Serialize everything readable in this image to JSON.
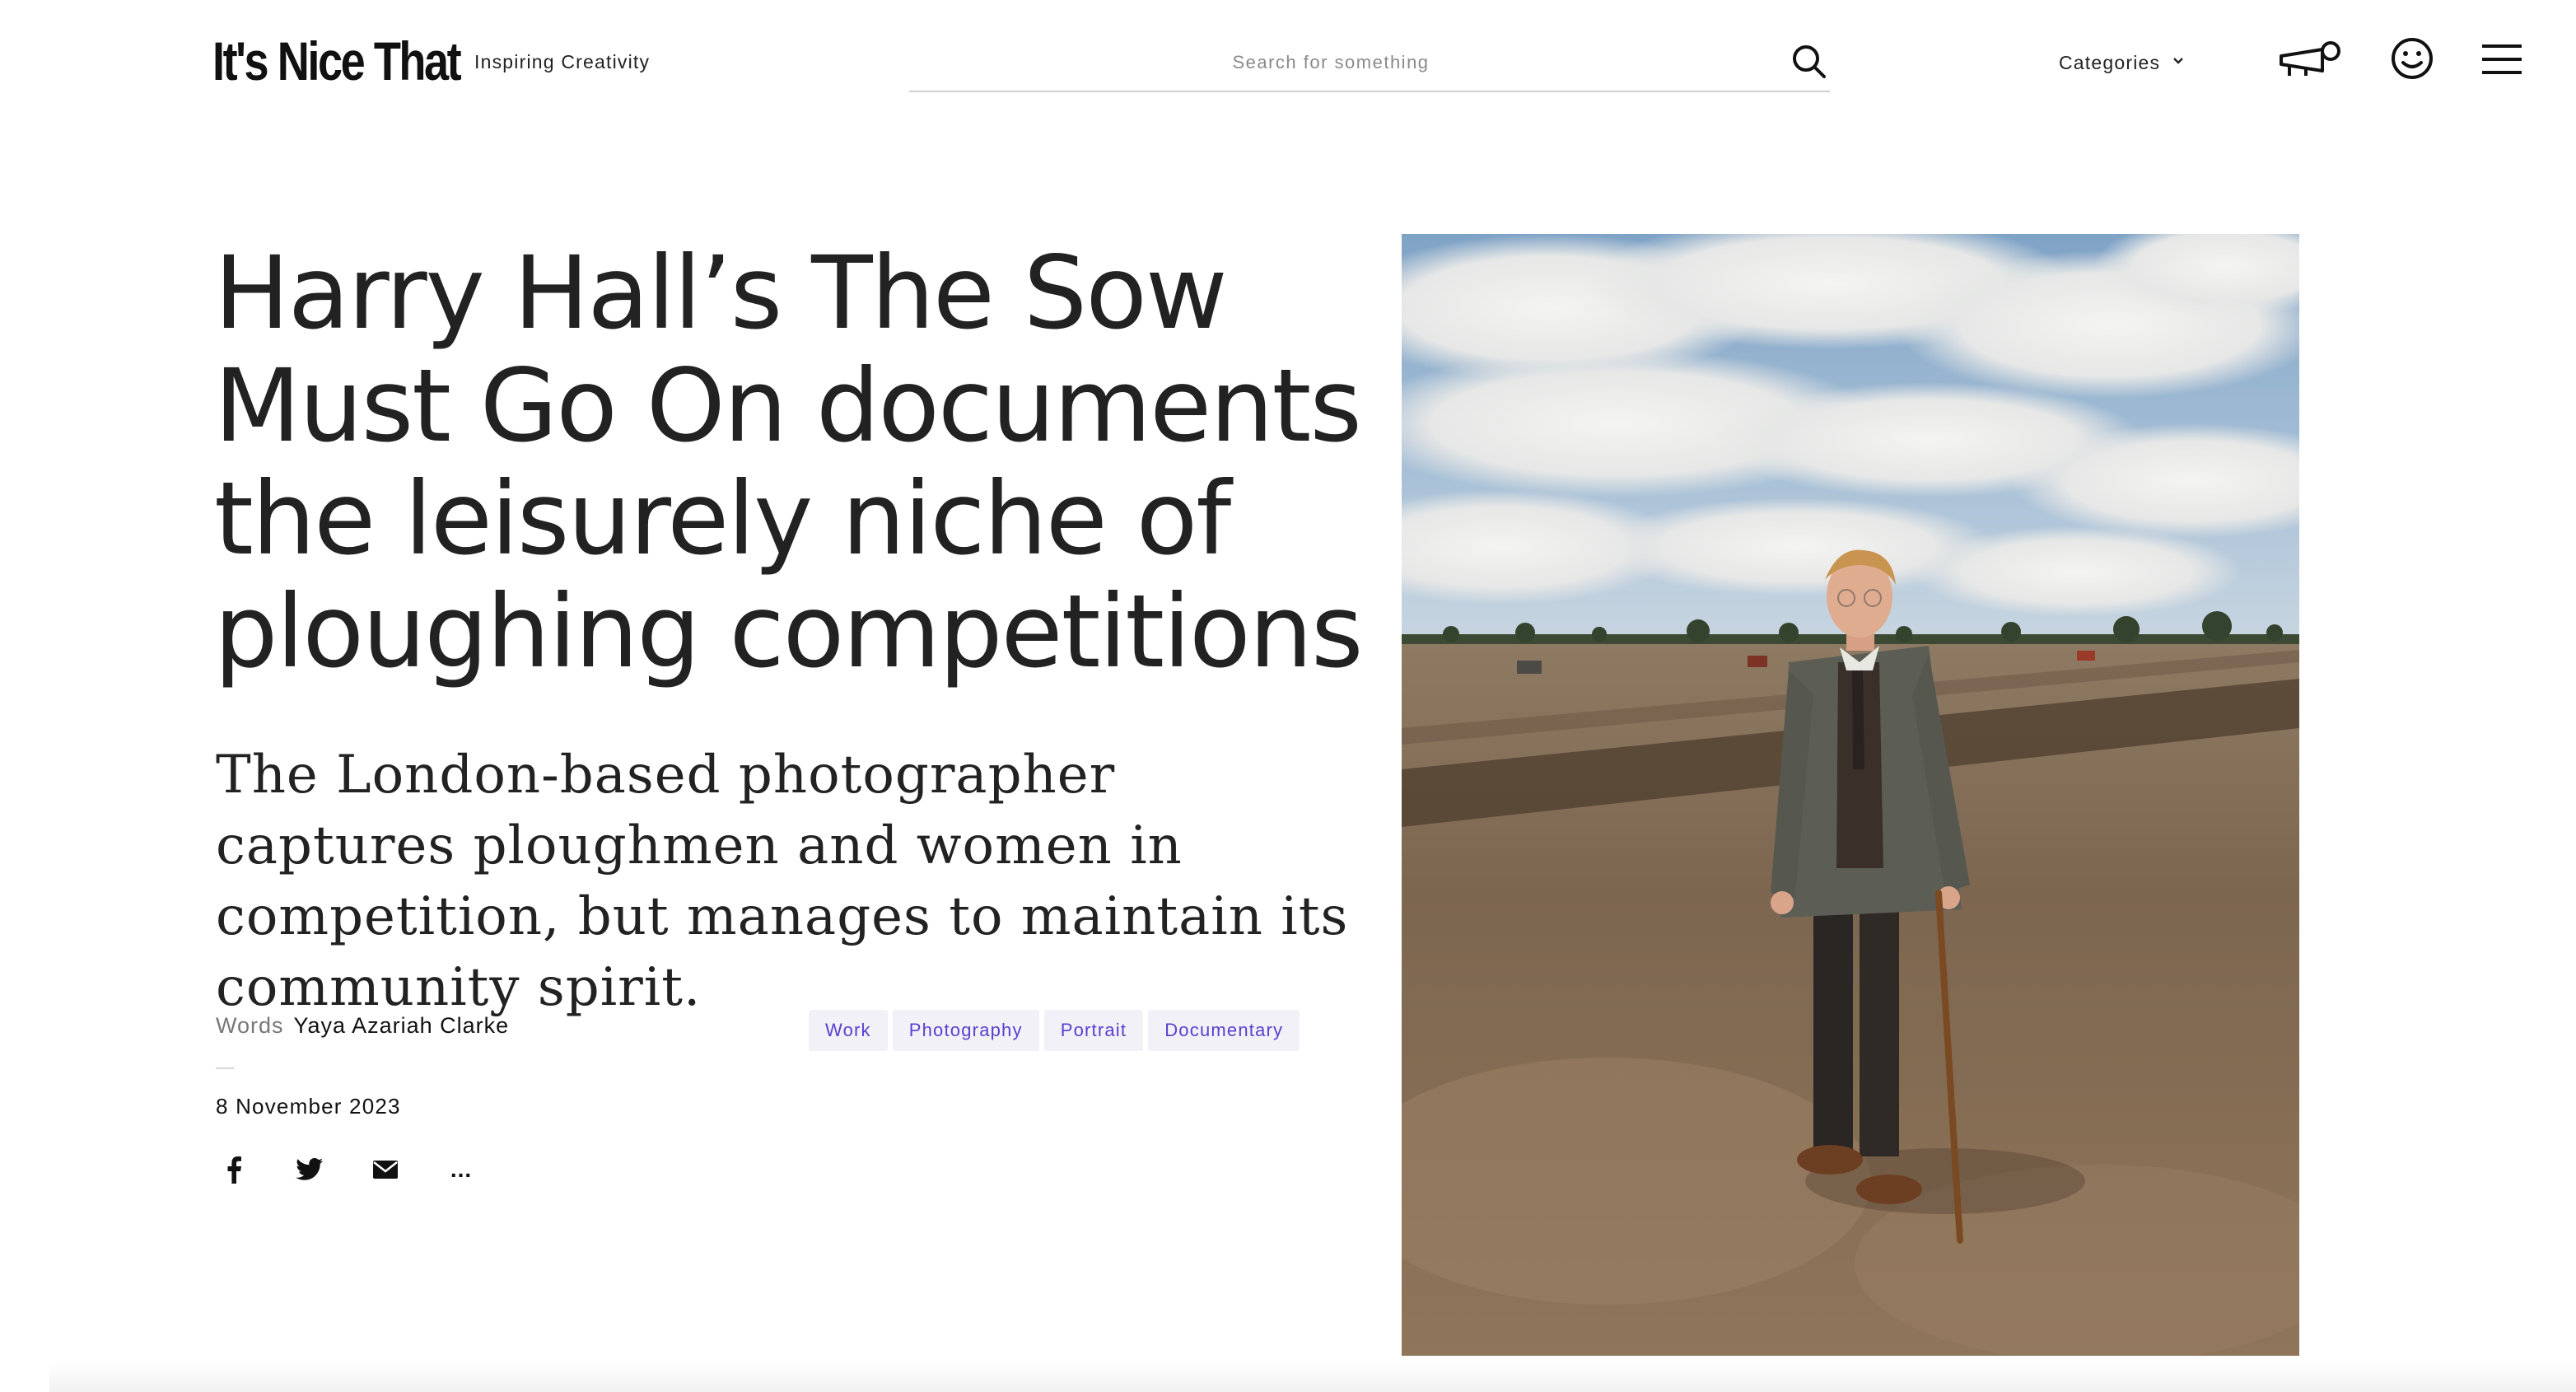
{
  "header": {
    "logo_text": "It's Nice That",
    "tagline": "Inspiring Creativity",
    "search": {
      "placeholder": "Search for something",
      "value": ""
    },
    "categories_label": "Categories",
    "icons": [
      "search-icon",
      "chevron-down-icon",
      "megaphone-icon",
      "smiley-icon",
      "hamburger-menu-icon"
    ]
  },
  "article": {
    "title": "Harry Hall’s The Sow Must Go On documents the leisurely niche of ploughing competitions",
    "standfirst": "The London-based photographer captures ploughmen and women in competition, but manages to maintain its community spirit.",
    "byline_prefix": "Words",
    "author": "Yaya Azariah Clarke",
    "date": "8 November 2023",
    "tags": [
      "Work",
      "Photography",
      "Portrait",
      "Documentary"
    ],
    "share": {
      "more_label": "...",
      "icons": [
        "facebook-icon",
        "twitter-icon",
        "email-icon",
        "more-icon"
      ]
    }
  },
  "hero_image": {
    "subject": "man in tweed jacket with walking stick standing in ploughed field"
  },
  "colors": {
    "tag_text": "#5a3fd0",
    "tag_bg": "#f2f1f7",
    "title_text": "#222222",
    "divider": "#cfcfcf"
  }
}
